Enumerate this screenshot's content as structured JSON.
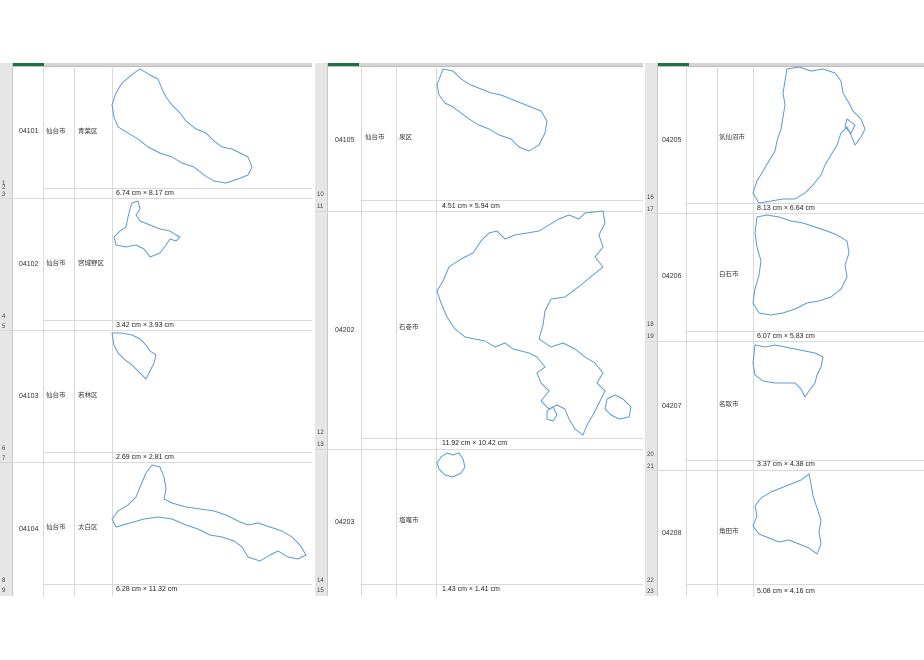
{
  "panels": [
    {
      "rows": [
        {
          "code": "04101",
          "city": "仙台市",
          "ward": "青葉区",
          "dims": "6.74 cm  ×  8.17 cm",
          "row_a": "2",
          "row_b": "3"
        },
        {
          "code": "04102",
          "city": "仙台市",
          "ward": "宮城野区",
          "dims": "3.42 cm  ×  3.93 cm",
          "row_a": "4",
          "row_b": "5"
        },
        {
          "code": "04103",
          "city": "仙台市",
          "ward": "若林区",
          "dims": "2.69 cm  ×  2.81 cm",
          "row_a": "6",
          "row_b": "7"
        },
        {
          "code": "04104",
          "city": "仙台市",
          "ward": "太白区",
          "dims": "6.28 cm  ×  11.32 cm",
          "row_a": "8",
          "row_b": "9"
        }
      ],
      "extra_rownum": "1"
    },
    {
      "rows": [
        {
          "code": "04105",
          "city": "仙台市",
          "ward": "泉区",
          "dims": "4.51 cm  ×  5.94 cm",
          "row_a": "10",
          "row_b": "11"
        },
        {
          "code": "04202",
          "city": "",
          "ward": "石巻市",
          "dims": "11.92 cm  ×  10.42 cm",
          "row_a": "12",
          "row_b": "13"
        },
        {
          "code": "04203",
          "city": "",
          "ward": "塩竈市",
          "dims": "1.43 cm  ×  1.41 cm",
          "row_a": "14",
          "row_b": "15"
        }
      ]
    },
    {
      "rows": [
        {
          "code": "04205",
          "city": "",
          "ward": "気仙沼市",
          "dims": "8.13 cm  ×  6.64 cm",
          "row_a": "16",
          "row_b": "17"
        },
        {
          "code": "04206",
          "city": "",
          "ward": "白石市",
          "dims": "6.07 cm  ×  5.83 cm",
          "row_a": "18",
          "row_b": "19"
        },
        {
          "code": "04207",
          "city": "",
          "ward": "名取市",
          "dims": "3.37 cm  ×  4.38 cm",
          "row_a": "20",
          "row_b": "21"
        },
        {
          "code": "04208",
          "city": "",
          "ward": "角田市",
          "dims": "5.08 cm  ×  4.16 cm",
          "row_a": "22",
          "row_b": "23"
        }
      ]
    }
  ]
}
